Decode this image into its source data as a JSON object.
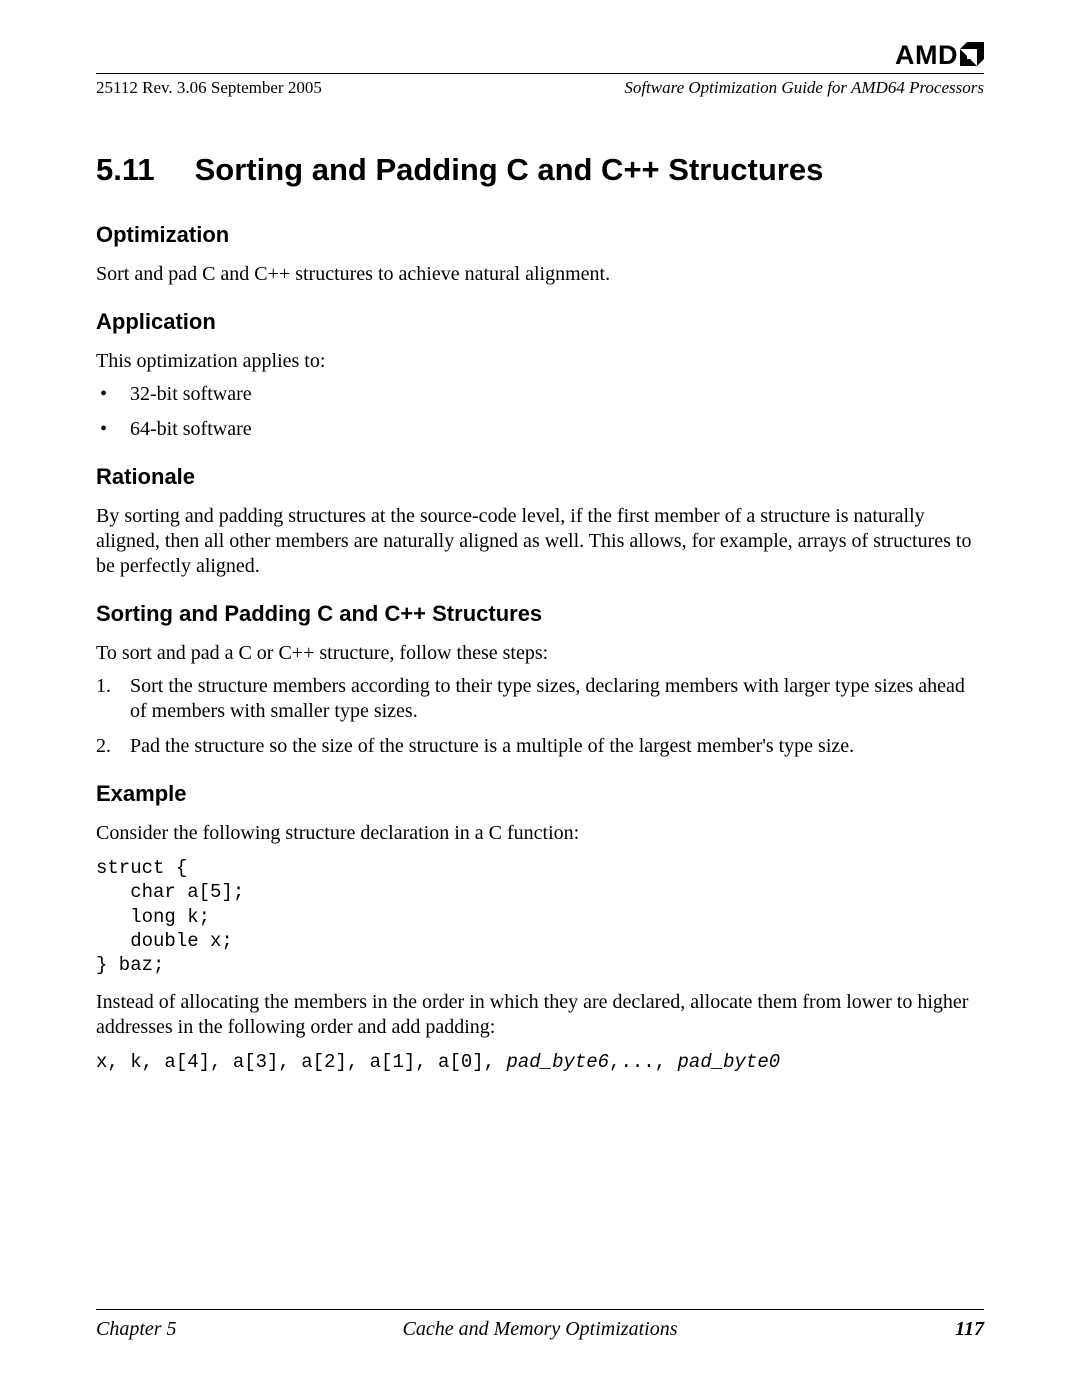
{
  "header": {
    "doc_id": "25112   Rev. 3.06   September 2005",
    "title": "Software Optimization Guide for AMD64 Processors",
    "logo_text": "AMD"
  },
  "section": {
    "number": "5.11",
    "title": "Sorting and Padding C and C++ Structures"
  },
  "optimization": {
    "heading": "Optimization",
    "text": "Sort and pad C and C++ structures to achieve natural alignment."
  },
  "application": {
    "heading": "Application",
    "lead": "This optimization applies to:",
    "items": [
      "32-bit software",
      "64-bit software"
    ]
  },
  "rationale": {
    "heading": "Rationale",
    "text": "By sorting and padding structures at the source-code level, if the first member of a structure is naturally aligned, then all other members are naturally aligned as well. This allows, for example, arrays of structures to be perfectly aligned."
  },
  "sortpad": {
    "heading": "Sorting and Padding C and C++ Structures",
    "lead": "To sort and pad a C or C++ structure, follow these steps:",
    "steps": [
      "Sort the structure members according to their type sizes, declaring members with larger type sizes ahead of members with smaller type sizes.",
      "Pad the structure so the size of the structure is a multiple of the largest member's type size."
    ]
  },
  "example": {
    "heading": "Example",
    "lead": "Consider the following structure declaration in a C function:",
    "code": "struct {\n   char a[5];\n   long k;\n   double x;\n} baz;",
    "after_lead": "Instead of allocating the members in the order in which they are declared, allocate them from lower to higher addresses in the following order and add padding:",
    "code2_plain": "x, k, a[4], a[3], a[2], a[1], a[0], ",
    "code2_italic1": "pad_byte6",
    "code2_sep": ",..., ",
    "code2_italic2": "pad_byte0"
  },
  "footer": {
    "chapter": "Chapter 5",
    "title": "Cache and Memory Optimizations",
    "page": "117"
  }
}
